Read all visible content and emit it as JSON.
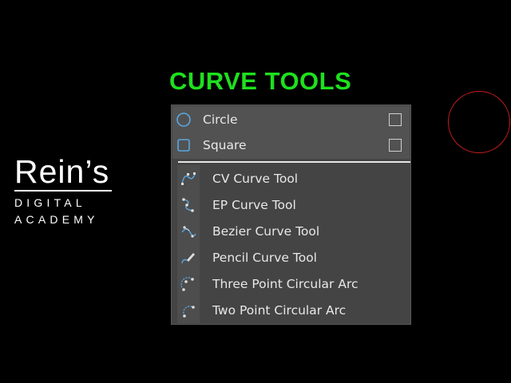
{
  "heading": "CURVE TOOLS",
  "logo": {
    "main": "Rein’s",
    "line1": "DIGITAL",
    "line2": "ACADEMY"
  },
  "menu": {
    "primitives": [
      {
        "label": "Circle",
        "icon": "circle-icon",
        "has_option_box": true
      },
      {
        "label": "Square",
        "icon": "square-icon",
        "has_option_box": true
      }
    ],
    "tools": [
      {
        "label": "CV Curve Tool",
        "icon": "cv-curve-icon"
      },
      {
        "label": "EP Curve Tool",
        "icon": "ep-curve-icon"
      },
      {
        "label": "Bezier Curve Tool",
        "icon": "bezier-curve-icon"
      },
      {
        "label": "Pencil Curve Tool",
        "icon": "pencil-curve-icon"
      },
      {
        "label": "Three Point Circular Arc",
        "icon": "three-point-arc-icon"
      },
      {
        "label": "Two Point Circular Arc",
        "icon": "two-point-arc-icon"
      }
    ]
  },
  "colors": {
    "heading": "#1ee01e",
    "icon_blue": "#5aa7e0",
    "highlight_ring": "#c81d1d"
  }
}
